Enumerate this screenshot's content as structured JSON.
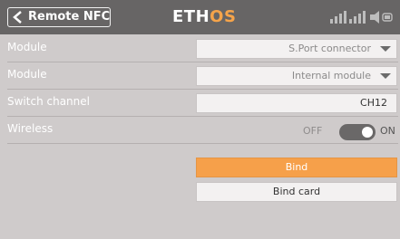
{
  "header": {
    "back_label": "Remote NFC",
    "logo_left": "ETH",
    "logo_right": "OS"
  },
  "rows": [
    {
      "label": "Module",
      "value": "S.Port connector",
      "dropdown": true
    },
    {
      "label": "Module",
      "value": "Internal module",
      "dropdown": true
    },
    {
      "label": "Switch channel",
      "value": "CH12",
      "dropdown": false
    },
    {
      "label": "Wireless",
      "toggle_off": "OFF",
      "toggle_on": "ON"
    }
  ],
  "buttons": {
    "bind": "Bind",
    "bind_card": "Bind card"
  },
  "colors": {
    "header_bg": "#676565",
    "body_bg": "#cfcbcb",
    "accent": "#f6a04a"
  }
}
